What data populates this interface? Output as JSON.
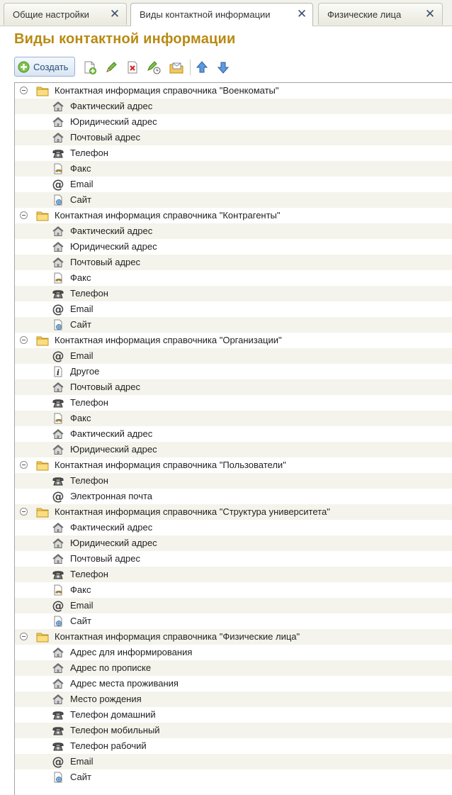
{
  "tabs": [
    {
      "label": "Общие настройки",
      "active": false
    },
    {
      "label": "Виды контактной информации",
      "active": true
    },
    {
      "label": "Физические лица",
      "active": false
    }
  ],
  "page_title": "Виды контактной информации",
  "toolbar": {
    "create_label": "Создать",
    "icons": [
      "add-copy-icon",
      "edit-icon",
      "delete-icon",
      "edit-schedule-icon",
      "mail-folder-icon",
      "move-up-icon",
      "move-down-icon"
    ]
  },
  "colors": {
    "title": "#b88a12",
    "alt_row": "#f4f4ec",
    "create_button_text": "#2b4e7a"
  },
  "tree": [
    {
      "label": "Контактная информация справочника \"Военкоматы\"",
      "items": [
        {
          "label": "Фактический адрес",
          "icon": "house-icon"
        },
        {
          "label": "Юридический адрес",
          "icon": "house-icon"
        },
        {
          "label": "Почтовый адрес",
          "icon": "house-icon"
        },
        {
          "label": "Телефон",
          "icon": "phone-icon"
        },
        {
          "label": "Факс",
          "icon": "fax-icon"
        },
        {
          "label": "Email",
          "icon": "email-icon"
        },
        {
          "label": "Сайт",
          "icon": "site-icon"
        }
      ]
    },
    {
      "label": "Контактная информация справочника \"Контрагенты\"",
      "items": [
        {
          "label": "Фактический адрес",
          "icon": "house-icon"
        },
        {
          "label": "Юридический адрес",
          "icon": "house-icon"
        },
        {
          "label": "Почтовый адрес",
          "icon": "house-icon"
        },
        {
          "label": "Факс",
          "icon": "fax-icon"
        },
        {
          "label": "Телефон",
          "icon": "phone-icon"
        },
        {
          "label": "Email",
          "icon": "email-icon"
        },
        {
          "label": "Сайт",
          "icon": "site-icon"
        }
      ]
    },
    {
      "label": "Контактная информация справочника \"Организации\"",
      "items": [
        {
          "label": "Email",
          "icon": "email-icon"
        },
        {
          "label": "Другое",
          "icon": "info-icon"
        },
        {
          "label": "Почтовый адрес",
          "icon": "house-icon"
        },
        {
          "label": "Телефон",
          "icon": "phone-icon"
        },
        {
          "label": "Факс",
          "icon": "fax-icon"
        },
        {
          "label": "Фактический адрес",
          "icon": "house-icon"
        },
        {
          "label": "Юридический адрес",
          "icon": "house-icon"
        }
      ]
    },
    {
      "label": "Контактная информация справочника \"Пользователи\"",
      "items": [
        {
          "label": "Телефон",
          "icon": "phone-icon"
        },
        {
          "label": "Электронная почта",
          "icon": "email-icon"
        }
      ]
    },
    {
      "label": "Контактная информация справочника \"Структура университета\"",
      "items": [
        {
          "label": "Фактический адрес",
          "icon": "house-icon"
        },
        {
          "label": "Юридический адрес",
          "icon": "house-icon"
        },
        {
          "label": "Почтовый адрес",
          "icon": "house-icon"
        },
        {
          "label": "Телефон",
          "icon": "phone-icon"
        },
        {
          "label": "Факс",
          "icon": "fax-icon"
        },
        {
          "label": "Email",
          "icon": "email-icon"
        },
        {
          "label": "Сайт",
          "icon": "site-icon"
        }
      ]
    },
    {
      "label": "Контактная информация справочника \"Физические лица\"",
      "items": [
        {
          "label": "Адрес для информирования",
          "icon": "house-icon"
        },
        {
          "label": "Адрес по прописке",
          "icon": "house-icon"
        },
        {
          "label": "Адрес места проживания",
          "icon": "house-icon"
        },
        {
          "label": "Место рождения",
          "icon": "house-icon"
        },
        {
          "label": "Телефон домашний",
          "icon": "phone-icon"
        },
        {
          "label": "Телефон мобильный",
          "icon": "phone-icon"
        },
        {
          "label": "Телефон рабочий",
          "icon": "phone-icon"
        },
        {
          "label": "Email",
          "icon": "email-icon"
        },
        {
          "label": "Сайт",
          "icon": "site-icon"
        }
      ]
    }
  ]
}
